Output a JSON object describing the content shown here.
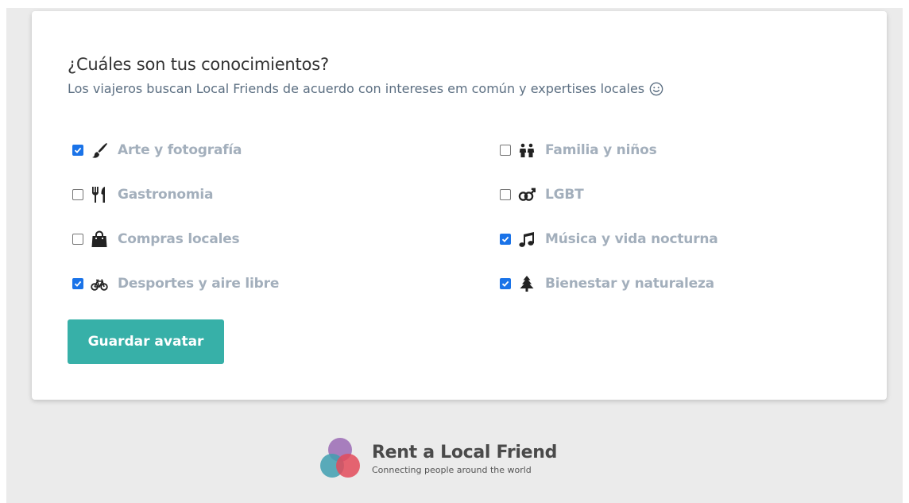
{
  "card": {
    "title": "¿Cuáles son tus conocimientos?",
    "subtitle": "Los viajeros buscan Local Friends de acuerdo con intereses em común y expertises locales",
    "smile_icon": "smile-icon"
  },
  "options": [
    {
      "label": "Arte y fotografía",
      "checked": true,
      "icon": "paintbrush-icon"
    },
    {
      "label": "Familia y niños",
      "checked": false,
      "icon": "family-icon"
    },
    {
      "label": "Gastronomia",
      "checked": false,
      "icon": "utensils-icon"
    },
    {
      "label": "LGBT",
      "checked": false,
      "icon": "gender-icon"
    },
    {
      "label": "Compras locales",
      "checked": false,
      "icon": "shopping-bag-icon"
    },
    {
      "label": "Música y vida nocturna",
      "checked": true,
      "icon": "music-note-icon"
    },
    {
      "label": "Desportes y aire libre",
      "checked": true,
      "icon": "bicycle-icon"
    },
    {
      "label": "Bienestar y naturaleza",
      "checked": true,
      "icon": "tree-icon"
    }
  ],
  "save_button": "Guardar avatar",
  "footer": {
    "brand": "Rent a Local Friend",
    "tagline": "Connecting people around the world"
  },
  "colors": {
    "accent": "#37b0a8",
    "checkbox": "#1a73e8",
    "option_text": "#a3afbc",
    "subtitle_text": "#5c6f82",
    "background": "#ebebeb"
  }
}
